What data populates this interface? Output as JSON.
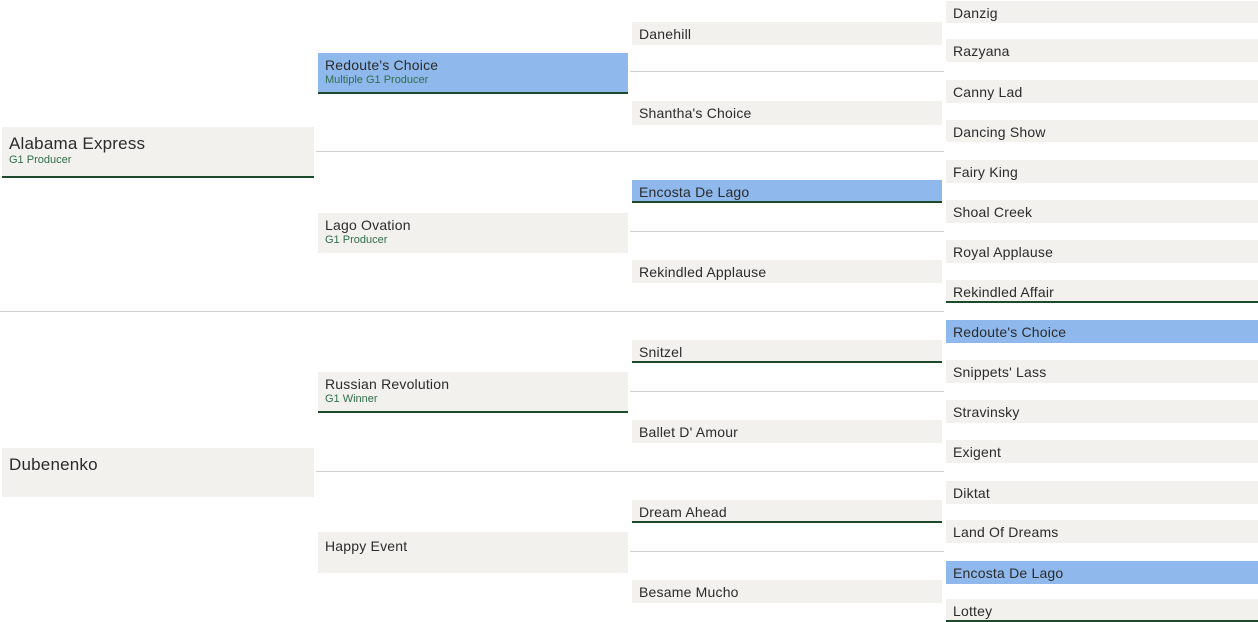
{
  "pedigree": {
    "gen1": [
      {
        "name": "Alabama Express",
        "sub": "G1 Producer"
      },
      {
        "name": "Dubenenko",
        "sub": ""
      }
    ],
    "gen2": [
      {
        "name": "Redoute's Choice",
        "sub": "Multiple G1 Producer"
      },
      {
        "name": "Lago Ovation",
        "sub": "G1 Producer"
      },
      {
        "name": "Russian Revolution",
        "sub": "G1 Winner"
      },
      {
        "name": "Happy Event",
        "sub": ""
      }
    ],
    "gen3": [
      {
        "name": "Danehill"
      },
      {
        "name": "Shantha's Choice"
      },
      {
        "name": "Encosta De Lago"
      },
      {
        "name": "Rekindled Applause"
      },
      {
        "name": "Snitzel"
      },
      {
        "name": "Ballet D' Amour"
      },
      {
        "name": "Dream Ahead"
      },
      {
        "name": "Besame Mucho"
      }
    ],
    "gen4": [
      {
        "name": "Danzig"
      },
      {
        "name": "Razyana"
      },
      {
        "name": "Canny Lad"
      },
      {
        "name": "Dancing Show"
      },
      {
        "name": "Fairy King"
      },
      {
        "name": "Shoal Creek"
      },
      {
        "name": "Royal Applause"
      },
      {
        "name": "Rekindled Affair"
      },
      {
        "name": "Redoute's Choice"
      },
      {
        "name": "Snippets' Lass"
      },
      {
        "name": "Stravinsky"
      },
      {
        "name": "Exigent"
      },
      {
        "name": "Diktat"
      },
      {
        "name": "Land Of Dreams"
      },
      {
        "name": "Encosta De Lago"
      },
      {
        "name": "Lottey"
      }
    ]
  },
  "colors": {
    "highlight": "#8fb9ec",
    "box": "#f3f1ee",
    "underline": "#1d4a2a",
    "subtext": "#2f6e4b"
  }
}
